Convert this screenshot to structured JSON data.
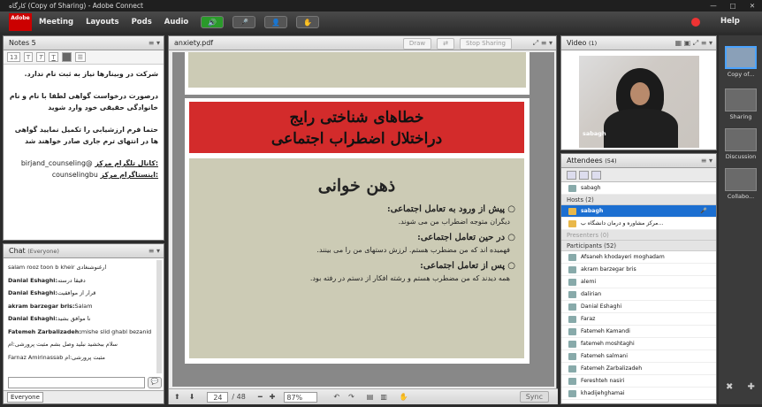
{
  "window": {
    "title": "كارگاه (Copy of Sharing) - Adobe Connect"
  },
  "menu": {
    "logo": "Adobe",
    "items": [
      "Meeting",
      "Layouts",
      "Pods",
      "Audio"
    ],
    "help": "Help"
  },
  "notes": {
    "title": "Notes 5",
    "font_size": "13",
    "lines": [
      "شرکت در وبینارها نیاز به ثبت نام ندارد.",
      "درصورت درخواست گواهی لطفا با نام و نام خانوادگی حقیقی خود وارد شوید",
      "حتما فرم ارزشیابی را تکمیل نمایید گواهی ها در انتهای ترم جاری صادر خواهند شد"
    ],
    "telegram_label": ":کانال تلگرام مرکز",
    "telegram_value": "@birjand_counseling",
    "instagram_label": ":اینستاگرام مرکز",
    "instagram_value": "counselingbu"
  },
  "chat": {
    "title": "Chat",
    "scope": "(Everyone)",
    "footer": "Everyone",
    "messages": [
      {
        "user": "",
        "text": "salam rooz toon b kheir ارغنوشنغادی"
      },
      {
        "user": "Danial Eshaghi:",
        "text": "دقیقا درسته"
      },
      {
        "user": "Danial Eshaghi:",
        "text": "قرار از موافقیت"
      },
      {
        "user": "akram barzegar bris:",
        "text": "Salam"
      },
      {
        "user": "Danial Eshaghi:",
        "text": "نا موافق بشید"
      },
      {
        "user": "Fatemeh Zarbalizadeh:",
        "text": "mishe slid ghabl bezanid"
      },
      {
        "user": "",
        "text": "سلام ببخشید نبلید وصل بشم  مثبت پرورشی:ام"
      },
      {
        "user": "",
        "text": "Farnaz Amirinassab مثبت پرورشی:ام"
      }
    ]
  },
  "share": {
    "title": "anxiety.pdf",
    "draw": "Draw",
    "stop": "Stop Sharing",
    "slide": {
      "title_line1": "خطاهای شناختی رایج",
      "title_line2": "دراختلال اضطراب اجتماعی",
      "heading": "ذهن خوانی",
      "b1": "پیش از ورود به تعامل اجتماعی:",
      "t1": "دیگران متوجه اضطراب من می شوند.",
      "b2": "در حین تعامل اجتماعی:",
      "t2": "فهمیده اند که من مضطرب هستم. لرزش دستهای من را می بینند.",
      "b3": "پس از تعامل اجتماعی:",
      "t3": "همه دیدند که من مضطرب هستم و رشته افکار از دستم در رفته بود."
    },
    "page": "24",
    "pages": "/ 48",
    "zoom": "87%",
    "sync": "Sync"
  },
  "video": {
    "title": "Video",
    "count": "(1)",
    "name": "sabagh"
  },
  "attendees": {
    "title": "Attendees",
    "count": "(54)",
    "me": "sabagh",
    "hosts_label": "Hosts (2)",
    "hosts": [
      "sabagh",
      "مرکز مشاوره و درمان دانشگاه ب..."
    ],
    "presenters_label": "Presenters (0)",
    "participants_label": "Participants (52)",
    "participants": [
      "Afsaneh khodayeri moghadam",
      "akram barzegar bris",
      "alemi",
      "dalirian",
      "Danial Eshaghi",
      "Faraz",
      "Fatemeh Kamandi",
      "fatemeh moshtaghi",
      "Fatemeh salmani",
      "Fatemeh Zarbalizadeh",
      "Fereshteh nasiri",
      "khadijehghamai"
    ]
  },
  "rail": {
    "items": [
      "Copy of...",
      "Sharing",
      "Discussion",
      "Collabo..."
    ]
  }
}
